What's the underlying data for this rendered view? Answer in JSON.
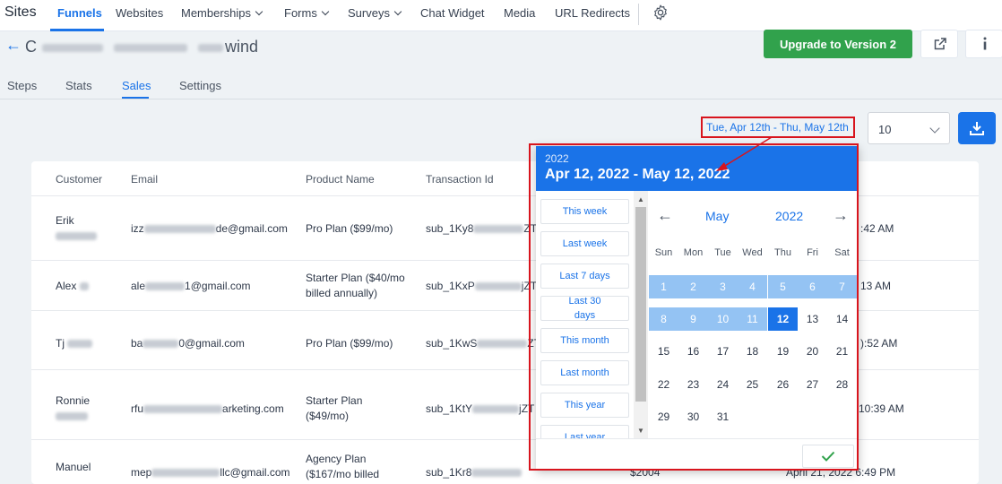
{
  "brand": "Sites",
  "nav": {
    "items": [
      {
        "label": "Funnels",
        "active": true
      },
      {
        "label": "Websites"
      },
      {
        "label": "Memberships",
        "dropdown": true
      },
      {
        "label": "Forms",
        "dropdown": true
      },
      {
        "label": "Surveys",
        "dropdown": true
      },
      {
        "label": "Chat Widget"
      },
      {
        "label": "Media"
      },
      {
        "label": "URL Redirects"
      }
    ],
    "settings_icon": "gear-icon"
  },
  "page": {
    "title_prefix": "C",
    "title_suffix": "wind",
    "upgrade_label": "Upgrade to Version 2",
    "open_icon": "external-link-icon",
    "info_icon": "info-icon"
  },
  "tabs": [
    {
      "label": "Steps"
    },
    {
      "label": "Stats"
    },
    {
      "label": "Sales",
      "active": true
    },
    {
      "label": "Settings"
    }
  ],
  "toolbar": {
    "date_range": "Tue, Apr 12th - Thu, May 12th",
    "page_size": "10",
    "download_icon": "download-icon"
  },
  "table": {
    "headers": [
      "Customer",
      "Email",
      "Product Name",
      "Transaction Id"
    ],
    "rows": [
      {
        "customer": "Erik",
        "email_end": "de@gmail.com",
        "email_start": "izz",
        "product": "Pro Plan ($99/mo)",
        "txn": "sub_1Ky8",
        "txn_end": "ZT",
        "time": ":42 AM"
      },
      {
        "customer": "Alex",
        "email_end": "1@gmail.com",
        "email_start": "ale",
        "product": "Starter Plan ($40/mo billed annually)",
        "txn": "sub_1KxP",
        "txn_end": "jZT",
        "time": "13 AM"
      },
      {
        "customer": "Tj",
        "email_end": "0@gmail.com",
        "email_start": "ba",
        "product": "Pro Plan ($99/mo)",
        "txn": "sub_1KwS",
        "txn_end": "ZT",
        "time": "):52 AM"
      },
      {
        "customer": "Ronnie",
        "email_end": "arketing.com",
        "email_start": "rfu",
        "product": "Starter Plan ($49/mo)",
        "txn": "sub_1KtY",
        "txn_end": "jZT",
        "time": "10:39 AM"
      },
      {
        "customer": "Manuel",
        "email_end": "llc@gmail.com",
        "email_start": "mep",
        "product": "Agency Plan ($167/mo billed",
        "txn": "sub_1Kr8",
        "txn_end": "",
        "amount": "$2004",
        "time": "April 21, 2022 6:49 PM"
      }
    ]
  },
  "datepicker": {
    "header_year": "2022",
    "header_range": "Apr 12, 2022 - May 12, 2022",
    "presets": [
      "This week",
      "Last week",
      "Last 7 days",
      "Last 30 days",
      "This month",
      "Last month",
      "This year",
      "Last year"
    ],
    "month": "May",
    "year": "2022",
    "weekdays": [
      "Sun",
      "Mon",
      "Tue",
      "Wed",
      "Thu",
      "Fri",
      "Sat"
    ],
    "weeks": [
      [
        "1",
        "2",
        "3",
        "4",
        "5",
        "6",
        "7"
      ],
      [
        "8",
        "9",
        "10",
        "11",
        "12",
        "13",
        "14"
      ],
      [
        "15",
        "16",
        "17",
        "18",
        "19",
        "20",
        "21"
      ],
      [
        "22",
        "23",
        "24",
        "25",
        "26",
        "27",
        "28"
      ],
      [
        "29",
        "30",
        "31",
        "",
        "",
        "",
        ""
      ]
    ],
    "in_range_through": 11,
    "selected_day": 12,
    "prev_icon": "arrow-left-icon",
    "next_icon": "arrow-right-icon",
    "confirm_icon": "check-icon"
  },
  "colors": {
    "accent": "#1a73e8",
    "upgrade": "#31a24c",
    "annotation": "#d8141d",
    "range": "#94c3f3"
  }
}
